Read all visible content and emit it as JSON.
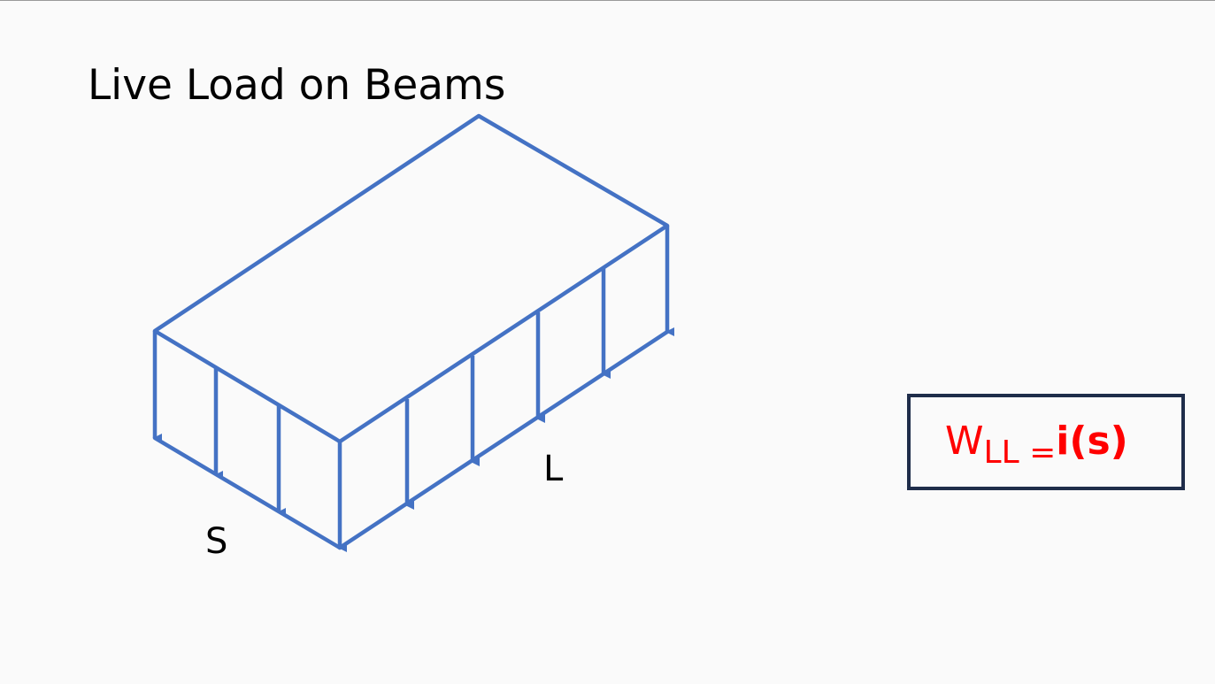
{
  "title": "Live Load on Beams",
  "diagram": {
    "label_short_span": "S",
    "label_long_span": "L",
    "line_color": "#4472c4"
  },
  "formula": {
    "main": "W",
    "subscript": "LL",
    "equals": "=",
    "expression": "i(s)",
    "color": "#ff0000",
    "box_border_color": "#1f2d4a"
  }
}
